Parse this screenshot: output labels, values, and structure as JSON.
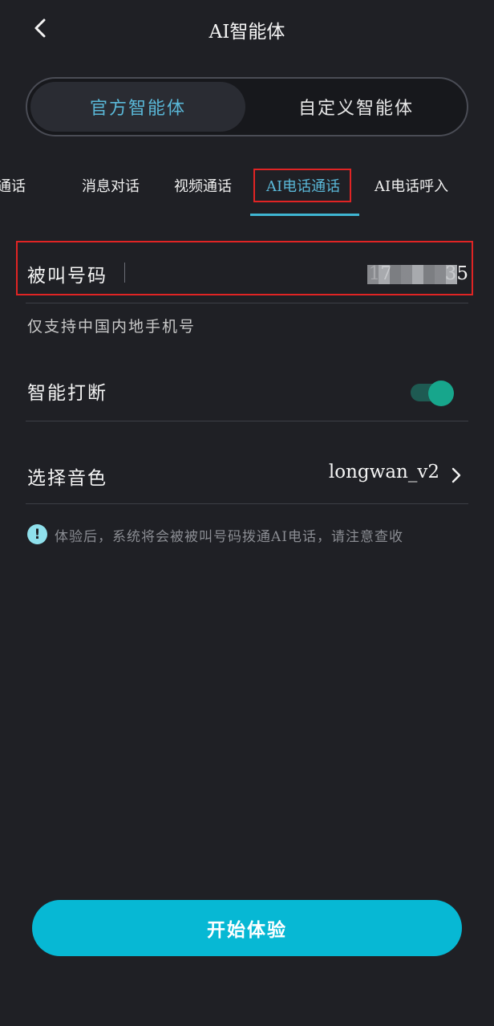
{
  "header": {
    "title": "AI智能体",
    "back_icon": "chevron-left-icon"
  },
  "segment": {
    "official_label": "官方智能体",
    "custom_label": "自定义智能体",
    "selected": "官方智能体"
  },
  "tabs": [
    {
      "label": "通话"
    },
    {
      "label": "消息对话"
    },
    {
      "label": "视频通话"
    },
    {
      "label": "AI电话通话",
      "active": true
    },
    {
      "label": "AI电话呼入"
    }
  ],
  "phone": {
    "label": "被叫号码",
    "value": "17         35",
    "hint": "仅支持中国内地手机号"
  },
  "interrupt": {
    "label": "智能打断",
    "enabled": true
  },
  "voice": {
    "label": "选择音色",
    "value": "longwan_v2"
  },
  "notice": {
    "icon": "info-icon",
    "text": "体验后，系统将会被被叫号码拨通AI电话，请注意查收"
  },
  "cta": {
    "label": "开始体验"
  },
  "colors": {
    "background": "#1f2025",
    "accent": "#5ab8d8",
    "button": "#07b8d4",
    "toggle_on": "#17a68c",
    "highlight_box": "#e02424"
  }
}
